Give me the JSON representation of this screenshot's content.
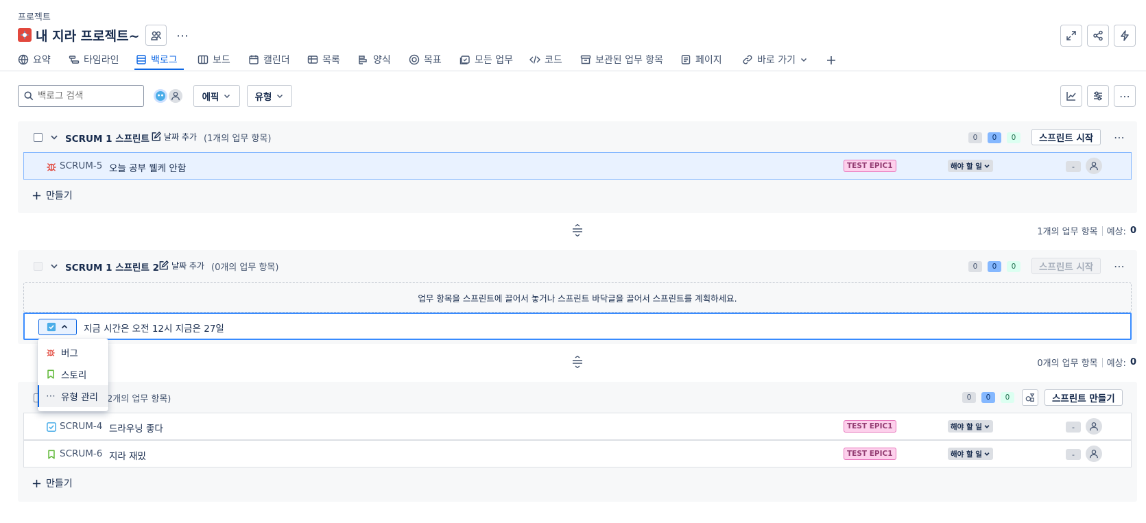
{
  "breadcrumb": "프로젝트",
  "project": {
    "title": "내 지라 프로젝트~"
  },
  "tabs": [
    {
      "label": "요약",
      "icon": "globe-icon"
    },
    {
      "label": "타임라인",
      "icon": "timeline-icon"
    },
    {
      "label": "백로그",
      "icon": "backlog-icon",
      "active": true
    },
    {
      "label": "보드",
      "icon": "board-icon"
    },
    {
      "label": "캘린더",
      "icon": "calendar-icon"
    },
    {
      "label": "목록",
      "icon": "list-icon"
    },
    {
      "label": "양식",
      "icon": "form-icon"
    },
    {
      "label": "목표",
      "icon": "target-icon"
    },
    {
      "label": "모든 업무",
      "icon": "all-work-icon"
    },
    {
      "label": "코드",
      "icon": "code-icon"
    },
    {
      "label": "보관된 업무 항목",
      "icon": "archive-icon"
    },
    {
      "label": "페이지",
      "icon": "page-icon"
    },
    {
      "label": "바로 가기",
      "icon": "link-icon"
    }
  ],
  "toolbar": {
    "search_placeholder": "백로그 검색",
    "epic_filter": "에픽",
    "type_filter": "유형"
  },
  "sprint1": {
    "title": "SCRUM 1 스프린트",
    "add_date": "날짜 추가",
    "count_text": "(1개의 업무 항목)",
    "counts": [
      "0",
      "0",
      "0"
    ],
    "start_button": "스프린트 시작",
    "issues": [
      {
        "key": "SCRUM-5",
        "summary": "오늘 공부 웰케 안함",
        "type": "bug",
        "epic": "TEST EPIC1",
        "status": "해야 할 일",
        "estimate": "-"
      }
    ],
    "create_label": "만들기",
    "footer_count": "1개의 업무 항목",
    "footer_estimate_label": "예상:",
    "footer_estimate_value": "0"
  },
  "sprint2": {
    "title": "SCRUM 1 스프린트 2",
    "add_date": "날짜 추가",
    "count_text": "(0개의 업무 항목)",
    "counts": [
      "0",
      "0",
      "0"
    ],
    "start_button": "스프린트 시작",
    "empty_hint": "업무 항목을 스프린트에 끌어서 놓거나 스프린트 바닥글을 끌어서 스프린트를 계획하세요.",
    "new_issue_text": "지금 시간은 오전 12시 지금은 27일",
    "footer_count": "0개의 업무 항목",
    "footer_estimate_label": "예상:",
    "footer_estimate_value": "0"
  },
  "type_menu": {
    "items": [
      {
        "label": "버그",
        "icon": "bug-icon"
      },
      {
        "label": "스토리",
        "icon": "story-icon"
      },
      {
        "label": "유형 관리",
        "icon": "more-icon"
      }
    ]
  },
  "backlog": {
    "count_text": "2개의 업무 항목)",
    "counts": [
      "0",
      "0",
      "0"
    ],
    "create_sprint_button": "스프린트 만들기",
    "issues": [
      {
        "key": "SCRUM-4",
        "summary": "드라우닝 좋다",
        "type": "task",
        "epic": "TEST EPIC1",
        "status": "해야 할 일",
        "estimate": "-"
      },
      {
        "key": "SCRUM-6",
        "summary": "지라 재밌",
        "type": "story",
        "epic": "TEST EPIC1",
        "status": "해야 할 일",
        "estimate": "-"
      }
    ],
    "create_label": "만들기"
  },
  "colors": {
    "accent": "#0c66e4",
    "bug": "#e2483d",
    "story": "#63ba3c",
    "task": "#4bade8"
  }
}
